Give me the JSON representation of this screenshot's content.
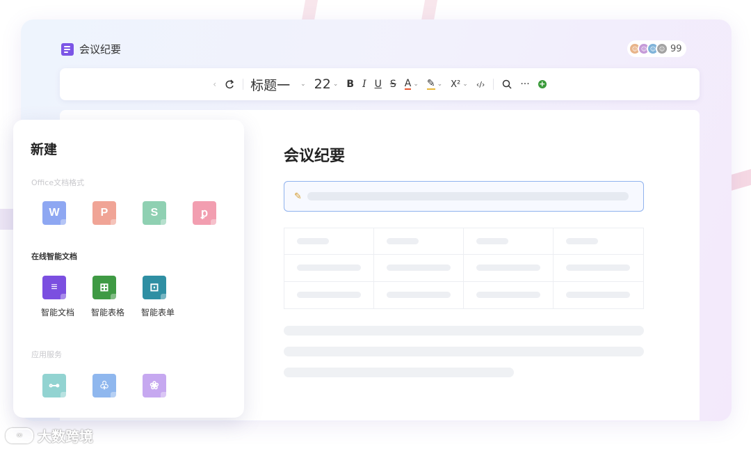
{
  "document": {
    "title": "会议纪要",
    "page_heading": "会议纪要"
  },
  "collaborators": {
    "count": "99"
  },
  "toolbar": {
    "heading_style": "标题一",
    "font_size": "22",
    "bold": "B",
    "italic": "I",
    "underline": "U",
    "strike": "S",
    "font_color": "A",
    "superscript": "X²",
    "code": "‹/›",
    "more": "···"
  },
  "new_panel": {
    "title": "新建",
    "office_section": {
      "label": "Office文档格式",
      "apps": [
        {
          "icon": "word-icon",
          "glyph": "W",
          "color": "#8ea7f2"
        },
        {
          "icon": "powerpoint-icon",
          "glyph": "P",
          "color": "#f0a496"
        },
        {
          "icon": "spreadsheet-icon",
          "glyph": "S",
          "color": "#8fd0b2"
        },
        {
          "icon": "pdf-icon",
          "glyph": "ꝑ",
          "color": "#f29eb0"
        }
      ]
    },
    "smart_section": {
      "label": "在线智能文档",
      "apps": [
        {
          "icon": "smart-doc-icon",
          "glyph": "≡",
          "label": "智能文档",
          "color": "#7b4fe0"
        },
        {
          "icon": "smart-sheet-icon",
          "glyph": "⊞",
          "label": "智能表格",
          "color": "#3f9a44"
        },
        {
          "icon": "smart-form-icon",
          "glyph": "⊡",
          "label": "智能表单",
          "color": "#2f8fa3"
        }
      ]
    },
    "services_section": {
      "label": "应用服务",
      "apps": [
        {
          "icon": "flowchart-icon",
          "glyph": "⊶",
          "color": "#92d3d1"
        },
        {
          "icon": "mindmap-icon",
          "glyph": "♧",
          "color": "#8fb7ee"
        },
        {
          "icon": "whiteboard-icon",
          "glyph": "❀",
          "color": "#c6a8f0"
        }
      ]
    }
  },
  "watermark": {
    "text": "大数跨境"
  },
  "colors": {
    "accent": "#7b55e6",
    "input_border": "#8fb2ee"
  }
}
